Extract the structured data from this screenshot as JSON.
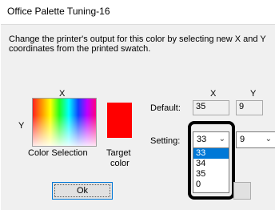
{
  "window": {
    "title": "Office Palette Tuning-16",
    "description": "Change the printer's output for this color by selecting new X and Y coordinates from the printed swatch."
  },
  "swatch": {
    "x_label": "X",
    "y_label": "Y",
    "caption": "Color Selection"
  },
  "target": {
    "caption_line1": "Target",
    "caption_line2": "color",
    "color": "#ff0000"
  },
  "coords": {
    "x_header": "X",
    "y_header": "Y",
    "default_label": "Default:",
    "default_x": "35",
    "default_y": "9",
    "setting_label": "Setting:",
    "setting_x": "33",
    "setting_y": "9"
  },
  "dropdown": {
    "options": [
      "33",
      "34",
      "35",
      "0"
    ],
    "selected": "33"
  },
  "buttons": {
    "ok_label": "Ok"
  }
}
